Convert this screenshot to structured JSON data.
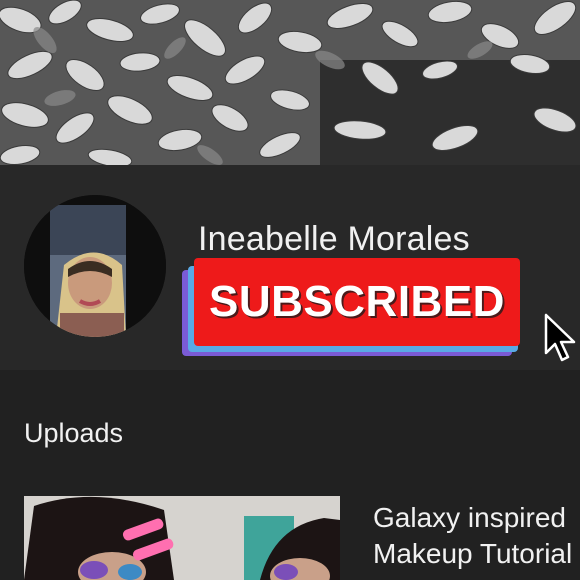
{
  "banner": {
    "icon": "leaves-banner-image"
  },
  "channel": {
    "name": "Ineabelle Morales",
    "avatar_icon": "profile-photo",
    "subscribe_label": "SUBSCRIBED",
    "subscribe_color": "#ee1a1a"
  },
  "uploads": {
    "section_title": "Uploads",
    "videos": [
      {
        "title_line1": "Galaxy inspired",
        "title_line2": "Makeup Tutorial"
      }
    ]
  },
  "cursor": {
    "icon": "mouse-pointer-icon"
  }
}
